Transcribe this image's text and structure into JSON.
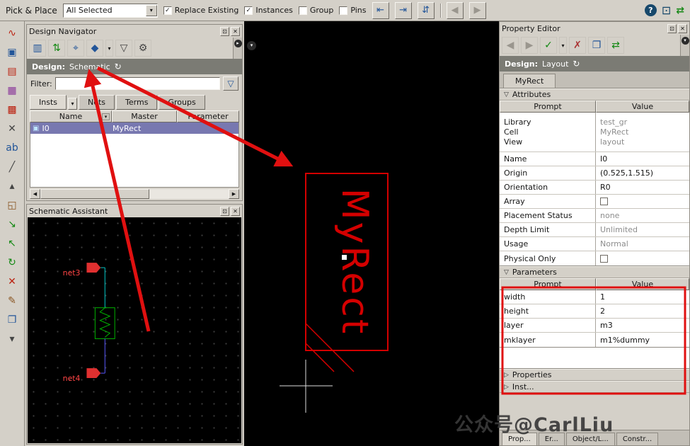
{
  "colors": {
    "annotation_red": "#e01010",
    "layout_red": "#d40000",
    "selection_purple": "#7878b0",
    "panel_gray": "#d4d0c8",
    "design_bar_gray": "#7b7b74",
    "net_red": "#ff4444",
    "component_green": "#00b400",
    "wire_cyan": "#00c8c8",
    "wire_blue": "#5858ff"
  },
  "icons": {
    "dropdown": "▾",
    "back": "◀",
    "forward": "▶",
    "close": "✕",
    "restore": "⊡",
    "refresh": "↻",
    "checkmark": "✓",
    "check": "✓",
    "section_open": "▽",
    "section_closed": "▷",
    "help": "?",
    "columns": "▥",
    "sort": "⇅",
    "probe": "⌖",
    "droplet": "◆",
    "funnel": "▽",
    "gear": "⚙",
    "filter_edit": "▽",
    "expander_right": "▸",
    "expander_down": "▾",
    "scroll_left": "◀",
    "scroll_right": "▶",
    "instance": "▣",
    "revert": "✗",
    "copy": "❐",
    "swap": "⇄",
    "window": "⊡",
    "align_a": "⇤",
    "align_b": "⇥",
    "align_c": "⇵"
  },
  "top_toolbar": {
    "title": "Pick & Place",
    "mode_select_value": "All Selected",
    "checkboxes": {
      "replace_existing": "Replace Existing",
      "instances": "Instances",
      "group": "Group",
      "pins": "Pins"
    }
  },
  "left_toolbar": {
    "icons": [
      {
        "name": "wire-icon",
        "glyph": "∿"
      },
      {
        "name": "instance-icon",
        "glyph": "▣"
      },
      {
        "name": "label-icon",
        "glyph": "▤"
      },
      {
        "name": "palette-icon",
        "glyph": "▦"
      },
      {
        "name": "via-icon",
        "glyph": "▩"
      },
      {
        "name": "deactivate-icon",
        "glyph": "✕"
      },
      {
        "name": "text-icon",
        "glyph": "ab"
      },
      {
        "name": "line-icon",
        "glyph": "╱"
      },
      {
        "name": "scroll-up-icon",
        "glyph": "▴"
      },
      {
        "name": "hierarchy-icon",
        "glyph": "◱"
      },
      {
        "name": "descend-icon",
        "glyph": "↘"
      },
      {
        "name": "ascend-icon",
        "glyph": "↖"
      },
      {
        "name": "update-icon",
        "glyph": "↻"
      },
      {
        "name": "delete-icon",
        "glyph": "✕"
      },
      {
        "name": "edit-icon",
        "glyph": "✎"
      },
      {
        "name": "copy-icon",
        "glyph": "❐"
      },
      {
        "name": "scroll-down-icon",
        "glyph": "▾"
      }
    ]
  },
  "design_navigator": {
    "title": "Design Navigator",
    "design_label": "Design:",
    "design_value": "Schematic",
    "filter_label": "Filter:",
    "filter_value": "",
    "tabs": [
      "Insts",
      "Nets",
      "Terms",
      "Groups"
    ],
    "table": {
      "columns": [
        "Name",
        "Master",
        "Parameter"
      ],
      "rows": [
        {
          "name": "I0",
          "master": "MyRect",
          "parameter": ""
        }
      ]
    }
  },
  "schematic_assistant": {
    "title": "Schematic Assistant",
    "net_labels": [
      "net3",
      "net4"
    ]
  },
  "canvas": {
    "cell_label": "MyRect"
  },
  "property_editor": {
    "title": "Property Editor",
    "design_label": "Design:",
    "design_value": "Layout",
    "tab": "MyRect",
    "attributes": {
      "label": "Attributes",
      "columns": [
        "Prompt",
        "Value"
      ],
      "rows": [
        {
          "prompt_lines": [
            "Library",
            "Cell",
            "View"
          ],
          "value_lines": [
            "test_gr",
            "MyRect",
            "layout"
          ]
        },
        {
          "prompt": "Name",
          "value": "I0"
        },
        {
          "prompt": "Origin",
          "value": "(0.525,1.515)"
        },
        {
          "prompt": "Orientation",
          "value": "R0"
        },
        {
          "prompt": "Array",
          "value": ""
        },
        {
          "prompt": "Placement Status",
          "value": "none"
        },
        {
          "prompt": "Depth Limit",
          "value": "Unlimited"
        },
        {
          "prompt": "Usage",
          "value": "Normal"
        },
        {
          "prompt": "Physical Only",
          "value": ""
        }
      ]
    },
    "parameters": {
      "label": "Parameters",
      "columns": [
        "Prompt",
        "Value"
      ],
      "rows": [
        {
          "prompt": "width",
          "value": "1"
        },
        {
          "prompt": "height",
          "value": "2"
        },
        {
          "prompt": "layer",
          "value": "m3"
        },
        {
          "prompt": "mklayer",
          "value": "m1%dummy"
        }
      ]
    },
    "properties_label": "Properties",
    "inst_label": "Inst...",
    "bottom_tabs": [
      "Prop...",
      "Er...",
      "Object/L...",
      "Constr..."
    ]
  },
  "watermark": {
    "text": "公众号@CarlLiu"
  }
}
